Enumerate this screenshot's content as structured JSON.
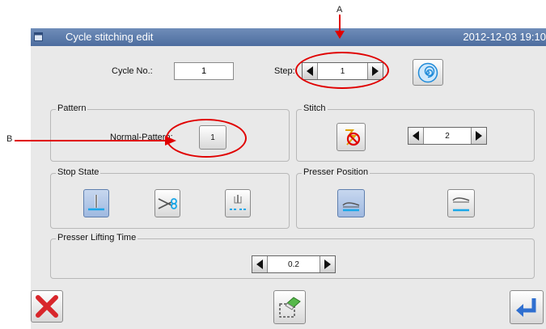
{
  "title_bar": {
    "title": "Cycle stitching edit",
    "datetime": "2012-12-03  19:10"
  },
  "cycle_no": {
    "label": "Cycle No.:",
    "value": "1"
  },
  "step": {
    "label": "Step:",
    "value": "1"
  },
  "pattern": {
    "legend": "Pattern",
    "type_label": "Normal-Pattern:",
    "number": "1"
  },
  "stitch": {
    "legend": "Stitch",
    "value": "2"
  },
  "stop_state": {
    "legend": "Stop State",
    "options": [
      "needle-stop-icon",
      "thread-trim-icon",
      "needle-up-icon"
    ],
    "selected_index": 0
  },
  "presser_position": {
    "legend": "Presser Position",
    "options": [
      "presser-down-icon",
      "presser-up-icon"
    ],
    "selected_index": 0
  },
  "presser_lifting_time": {
    "legend": "Presser Lifting Time",
    "value": "0.2"
  },
  "annotations": {
    "a": "A",
    "b": "B"
  },
  "colors": {
    "annotation": "#e00000",
    "title_bar": "#5a79a9",
    "selected": "#a8c0e4",
    "cancel": "#d8262b",
    "enter": "#2f6fd0"
  }
}
